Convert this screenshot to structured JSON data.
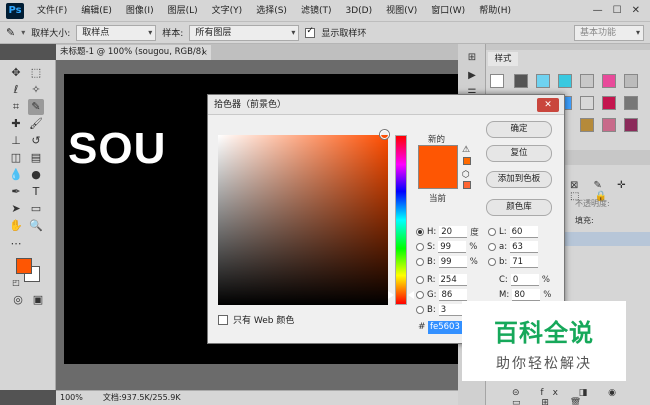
{
  "app": {
    "logo": "Ps",
    "menus": [
      "文件(F)",
      "编辑(E)",
      "图像(I)",
      "图层(L)",
      "文字(Y)",
      "选择(S)",
      "滤镜(T)",
      "3D(D)",
      "视图(V)",
      "窗口(W)",
      "帮助(H)"
    ],
    "window_controls": [
      "—",
      "☐",
      "✕"
    ]
  },
  "options_bar": {
    "tool_icon": "eyedropper-icon",
    "sample_size_label": "取样大小:",
    "sample_size_value": "取样点",
    "sample_label": "样本:",
    "sample_value": "所有图层",
    "show_ring_label": "显示取样环",
    "show_ring_checked": true,
    "workspace": "基本功能"
  },
  "document": {
    "tab_title": "未标题-1 @ 100% (sougou, RGB/8) *",
    "tab_close": "×",
    "canvas_text": "SOU",
    "zoom": "100%",
    "doc_info": "文档:937.5K/255.9K"
  },
  "styles_panel": {
    "tab_label": "样式"
  },
  "layers_panel": {
    "locks_label": "⊠ ✎ ✛ ⬚ 🔒",
    "opacity_label": "不透明度:",
    "fill_label": "填充:"
  },
  "color_picker": {
    "title": "拾色器（前景色）",
    "close_label": "✕",
    "new_label": "新的",
    "current_label": "当前",
    "new_color": "#fe5603",
    "buttons": {
      "ok": "确定",
      "reset": "复位",
      "add_swatch": "添加到色板",
      "libraries": "颜色库"
    },
    "web_only_label": "只有 Web 颜色",
    "fields": {
      "H": {
        "label": "H:",
        "value": "20",
        "unit": "度"
      },
      "S": {
        "label": "S:",
        "value": "99",
        "unit": "%"
      },
      "B": {
        "label": "B:",
        "value": "99",
        "unit": "%"
      },
      "R": {
        "label": "R:",
        "value": "254",
        "unit": ""
      },
      "G": {
        "label": "G:",
        "value": "86",
        "unit": ""
      },
      "Bl": {
        "label": "B:",
        "value": "3",
        "unit": ""
      },
      "L": {
        "label": "L:",
        "value": "60",
        "unit": ""
      },
      "a": {
        "label": "a:",
        "value": "63",
        "unit": ""
      },
      "b": {
        "label": "b:",
        "value": "71",
        "unit": ""
      },
      "C": {
        "label": "C:",
        "value": "0",
        "unit": "%"
      },
      "M": {
        "label": "M:",
        "value": "80",
        "unit": "%"
      }
    },
    "hex_label": "#",
    "hex_value": "fe5603"
  },
  "watermark": {
    "main": "百科全说",
    "sub": "助你轻松解决"
  }
}
